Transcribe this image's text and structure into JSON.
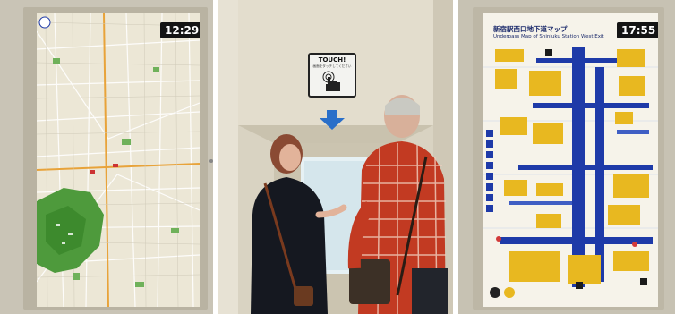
{
  "left_kiosk": {
    "clock": "12:29"
  },
  "center_kiosk": {
    "sign_title": "TOUCH!",
    "sign_subtitle": "画面をタッチしてください"
  },
  "right_kiosk": {
    "clock": "17:55",
    "title_jp": "新宿駅西口地下道マップ",
    "title_en": "Underpass Map of Shinjuku Station West Exit"
  },
  "colors": {
    "map_base": "#ede8d6",
    "park_green": "#4e9a3c",
    "underpass_blue": "#1e3aa8",
    "building_yellow": "#e8b820",
    "arrow_blue": "#2a6fc9"
  }
}
